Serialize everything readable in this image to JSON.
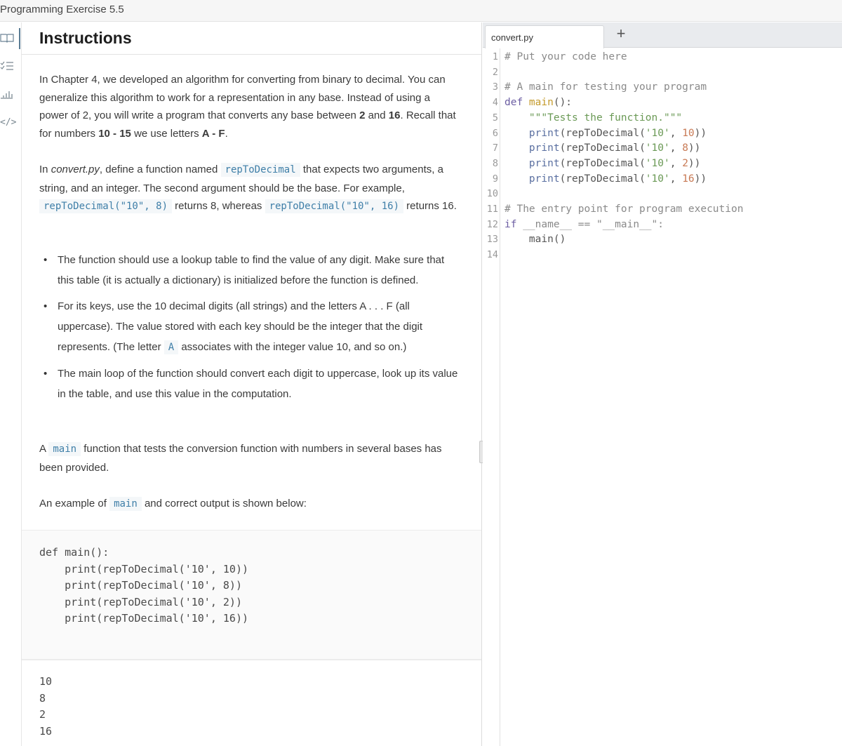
{
  "window": {
    "title": "Programming Exercise 5.5"
  },
  "sidebar": {
    "items": [
      {
        "name": "instructions",
        "icon": "book-icon",
        "glyph": "▯▯",
        "active": true
      },
      {
        "name": "checklist",
        "icon": "checklist-icon",
        "glyph": "≡"
      },
      {
        "name": "results",
        "icon": "bar-chart-icon",
        "glyph": "▁▃▅"
      },
      {
        "name": "code",
        "icon": "code-icon",
        "glyph": "</>"
      }
    ]
  },
  "instructions": {
    "heading": "Instructions",
    "p1": {
      "t1": "In Chapter 4, we developed an algorithm for converting from binary to decimal. You can generalize this algorithm to work for a representation in any base. Instead of using a power of 2, you will write a program that converts any base between ",
      "b1": "2",
      "t2": " and ",
      "b2": "16",
      "t3": ". Recall that for numbers ",
      "b3": "10 - 15",
      "t4": " we use letters ",
      "b4": "A - F",
      "t5": "."
    },
    "p2": {
      "t1": "In ",
      "em": "convert.py",
      "t2": ", define a function named ",
      "c1": "repToDecimal",
      "t3": " that expects two arguments, a string, and an integer. The second argument should be the base. For example, ",
      "c2": "repToDecimal(\"10\", 8)",
      "t4": " returns 8, whereas ",
      "c3": "repToDecimal(\"10\", 16)",
      "t5": " returns 16."
    },
    "bullets": [
      {
        "text": "The function should use a lookup table to find the value of any digit. Make sure that this table (it is actually a dictionary) is initialized before the function is defined."
      },
      {
        "t1": "For its keys, use the 10 decimal digits (all strings) and the letters A . . . F (all uppercase). The value stored with each key should be the integer that the digit represents. (The letter ",
        "code": "A",
        "t2": " associates with the integer value 10, and so on.)"
      },
      {
        "text": "The main loop of the function should convert each digit to uppercase, look up its value in the table, and use this value in the computation."
      }
    ],
    "p3": {
      "t1": "A ",
      "code": "main",
      "t2": " function that tests the conversion function with numbers in several bases has been provided."
    },
    "p4": {
      "t1": "An example of ",
      "code": "main",
      "t2": " and correct output is shown below:"
    },
    "example_code": "def main():\n    print(repToDecimal('10', 10))\n    print(repToDecimal('10', 8))\n    print(repToDecimal('10', 2))\n    print(repToDecimal('10', 16))",
    "example_output": "10\n8\n2\n16"
  },
  "editor": {
    "tabs": [
      {
        "label": "convert.py",
        "active": true
      }
    ],
    "add_tab_label": "+",
    "lines": [
      {
        "n": "1",
        "tokens": [
          {
            "c": "cm",
            "t": "# Put your code here"
          }
        ]
      },
      {
        "n": "2",
        "tokens": []
      },
      {
        "n": "3",
        "tokens": [
          {
            "c": "cm",
            "t": "# A main for testing your program"
          }
        ]
      },
      {
        "n": "4",
        "tokens": [
          {
            "c": "kw",
            "t": "def "
          },
          {
            "c": "fn",
            "t": "main"
          },
          {
            "c": "df",
            "t": "():"
          }
        ]
      },
      {
        "n": "5",
        "tokens": [
          {
            "c": "df",
            "t": "    "
          },
          {
            "c": "st",
            "t": "\"\"\"Tests the function.\"\"\""
          }
        ]
      },
      {
        "n": "6",
        "tokens": [
          {
            "c": "df",
            "t": "    "
          },
          {
            "c": "bi",
            "t": "print"
          },
          {
            "c": "df",
            "t": "(repToDecimal("
          },
          {
            "c": "st",
            "t": "'10'"
          },
          {
            "c": "df",
            "t": ", "
          },
          {
            "c": "nm",
            "t": "10"
          },
          {
            "c": "df",
            "t": "))"
          }
        ]
      },
      {
        "n": "7",
        "tokens": [
          {
            "c": "df",
            "t": "    "
          },
          {
            "c": "bi",
            "t": "print"
          },
          {
            "c": "df",
            "t": "(repToDecimal("
          },
          {
            "c": "st",
            "t": "'10'"
          },
          {
            "c": "df",
            "t": ", "
          },
          {
            "c": "nm",
            "t": "8"
          },
          {
            "c": "df",
            "t": "))"
          }
        ]
      },
      {
        "n": "8",
        "tokens": [
          {
            "c": "df",
            "t": "    "
          },
          {
            "c": "bi",
            "t": "print"
          },
          {
            "c": "df",
            "t": "(repToDecimal("
          },
          {
            "c": "st",
            "t": "'10'"
          },
          {
            "c": "df",
            "t": ", "
          },
          {
            "c": "nm",
            "t": "2"
          },
          {
            "c": "df",
            "t": "))"
          }
        ]
      },
      {
        "n": "9",
        "tokens": [
          {
            "c": "df",
            "t": "    "
          },
          {
            "c": "bi",
            "t": "print"
          },
          {
            "c": "df",
            "t": "(repToDecimal("
          },
          {
            "c": "st",
            "t": "'10'"
          },
          {
            "c": "df",
            "t": ", "
          },
          {
            "c": "nm",
            "t": "16"
          },
          {
            "c": "df",
            "t": "))"
          }
        ]
      },
      {
        "n": "10",
        "tokens": []
      },
      {
        "n": "11",
        "tokens": [
          {
            "c": "cm",
            "t": "# The entry point for program execution"
          }
        ]
      },
      {
        "n": "12",
        "tokens": [
          {
            "c": "kw",
            "t": "if "
          },
          {
            "c": "cm",
            "t": "__name__ == \"__main__\":"
          }
        ]
      },
      {
        "n": "13",
        "tokens": [
          {
            "c": "df",
            "t": "    main()"
          }
        ]
      },
      {
        "n": "14",
        "tokens": []
      }
    ]
  }
}
